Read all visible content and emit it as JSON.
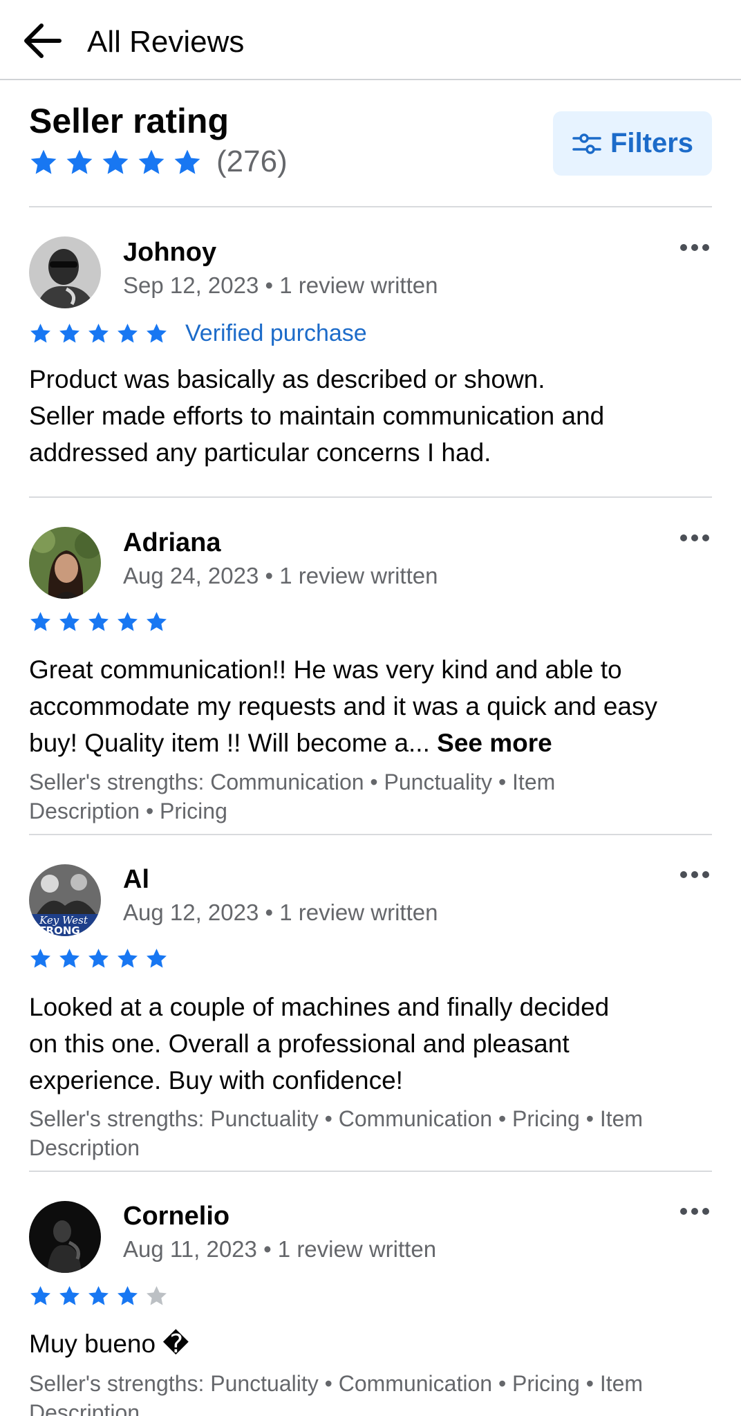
{
  "topbar": {
    "title": "All Reviews"
  },
  "rating": {
    "title": "Seller rating",
    "stars": 5,
    "count": "(276)",
    "filters_label": "Filters"
  },
  "colors": {
    "accent": "#1877f2",
    "empty_star": "#bcc0c4",
    "link": "#1c6bc9"
  },
  "reviews": [
    {
      "name": "Johnoy",
      "date": "Sep 12, 2023",
      "written": "1 review written",
      "stars": 5,
      "verified": "Verified purchase",
      "lines": [
        "Product was basically as described or shown.",
        "Seller made efforts to maintain communication and",
        "addressed any particular concerns I had."
      ]
    },
    {
      "name": "Adriana",
      "date": "Aug 24, 2023",
      "written": "1 review written",
      "stars": 5,
      "lines": [
        "Great communication!! He was very kind and able to",
        "accommodate my requests and it was a quick and easy",
        "buy! Quality item !! Will become a..."
      ],
      "see_more": "See more",
      "strengths": [
        "Seller's strengths: Communication • Punctuality • Item",
        "Description • Pricing"
      ]
    },
    {
      "name": "Al",
      "date": "Aug 12, 2023",
      "written": "1 review written",
      "stars": 5,
      "avatar_text": [
        "Key West",
        "TRONG"
      ],
      "lines": [
        "Looked at a couple of machines and finally decided",
        "on this one. Overall a professional and pleasant",
        "experience. Buy with confidence!"
      ],
      "strengths": [
        "Seller's strengths: Punctuality • Communication • Pricing • Item",
        "Description"
      ]
    },
    {
      "name": "Cornelio",
      "date": "Aug 11, 2023",
      "written": "1 review written",
      "stars": 4,
      "lines": [
        "Muy bueno �"
      ],
      "strengths": [
        "Seller's strengths: Punctuality • Communication • Pricing • Item",
        "Description"
      ]
    }
  ]
}
